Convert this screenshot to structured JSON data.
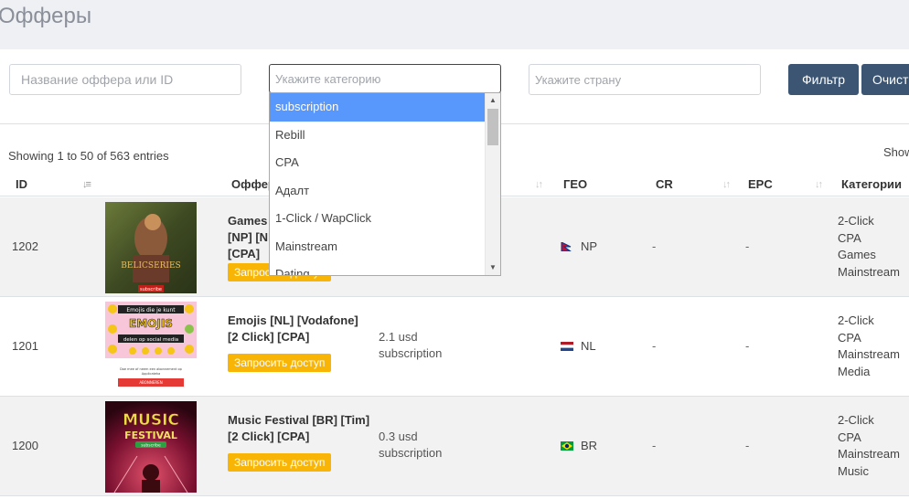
{
  "page": {
    "title": "Офферы"
  },
  "filters": {
    "offer_placeholder": "Название оффера или ID",
    "category_placeholder": "Укажите категорию",
    "country_placeholder": "Укажите страну",
    "filter_label": "Фильтр",
    "clear_label": "Очистить"
  },
  "category_dropdown": {
    "options": [
      "subscription",
      "Rebill",
      "CPA",
      "Адалт",
      "1-Click / WapClick",
      "Mainstream",
      "Dating"
    ],
    "highlighted": "subscription"
  },
  "table": {
    "info": "Showing 1 to 50 of 563 entries",
    "show_label": "Show",
    "headers": {
      "id": "ID",
      "offer": "Оффер",
      "geo": "ГЕО",
      "cr": "CR",
      "epc": "EPC",
      "categories": "Категории"
    },
    "request_label": "Запросить доступ",
    "rows": [
      {
        "id": "1202",
        "name": "Games [NP] [N",
        "name_line2": "[NP] [N",
        "name_line3": "[CPA]",
        "payout_amount": "",
        "payout_type": "",
        "geo": "NP",
        "cr": "-",
        "epc": "-",
        "categories": [
          "2-Click",
          "CPA",
          "Games",
          "Mainstream"
        ],
        "thumb_caption": "subscribe"
      },
      {
        "id": "1201",
        "name": "Emojis [NL] [Vodafone]",
        "name_line2": "[2 Click] [CPA]",
        "payout_amount": "2.1 usd",
        "payout_type": "subscription",
        "geo": "NL",
        "cr": "-",
        "epc": "-",
        "categories": [
          "2-Click",
          "CPA",
          "Mainstream",
          "Media"
        ],
        "thumb_caption": "Emojis die je kunt delen op social media",
        "thumb_sub": "Doe mee of neem een abonnement op Applicateka",
        "thumb_button": "ABONNEREN"
      },
      {
        "id": "1200",
        "name": "Music Festival [BR] [Tim]",
        "name_line2": "[2 Click] [CPA]",
        "payout_amount": "0.3 usd",
        "payout_type": "subscription",
        "geo": "BR",
        "cr": "-",
        "epc": "-",
        "categories": [
          "2-Click",
          "CPA",
          "Mainstream",
          "Music"
        ],
        "thumb_caption": "MUSIC FESTIVAL",
        "thumb_sub": "subscribe"
      }
    ]
  },
  "colors": {
    "button_dark": "#3b5572",
    "request_button": "#f9b506",
    "dropdown_highlight": "#5897fb"
  },
  "icons": {
    "sort": "sort-arrows-icon",
    "scroll": "scrollbar-arrow-icon"
  }
}
